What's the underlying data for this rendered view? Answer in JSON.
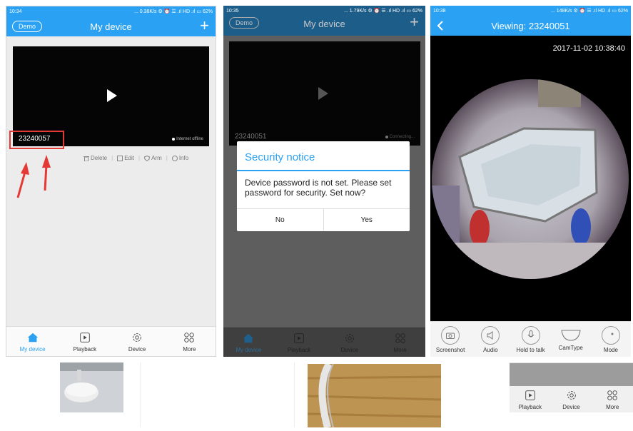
{
  "screens": [
    {
      "status": {
        "time": "10:34",
        "right": "... 0.38K/s ⚙ ⏰ ☰ .ıl HD .ıl ▭ 62%"
      },
      "title": "My device",
      "demo_label": "Demo",
      "device_id": "23240057",
      "online_status": "Internet offline",
      "actions": [
        "Delete",
        "Edit",
        "Arm",
        "Info"
      ]
    },
    {
      "status": {
        "time": "10:35",
        "right": "... 1.79K/s ⚙ ⏰ ☰ .ıl HD .ıl ▭ 62%"
      },
      "title": "My device",
      "demo_label": "Demo",
      "device_id": "23240051",
      "online_status": "Connecting...",
      "dialog": {
        "title": "Security notice",
        "message": "Device password is not set. Please set password for security. Set now?",
        "no_label": "No",
        "yes_label": "Yes"
      }
    },
    {
      "status": {
        "time": "10:38",
        "right": "... 148K/s ⚙ ⏰ ☰ .ıl HD .ıl ▭ 62%"
      },
      "title": "Viewing: 23240051",
      "timestamp": "2017-11-02 10:38:40",
      "controls": [
        "Screenshot",
        "Audio",
        "Hold to talk",
        "CamType",
        "Mode"
      ]
    }
  ],
  "tabs": [
    "My device",
    "Playback",
    "Device",
    "More"
  ],
  "partial_tabs": [
    "Playback",
    "Device",
    "More"
  ],
  "colors": {
    "accent": "#2aa1f2",
    "annotation": "#e53935"
  }
}
